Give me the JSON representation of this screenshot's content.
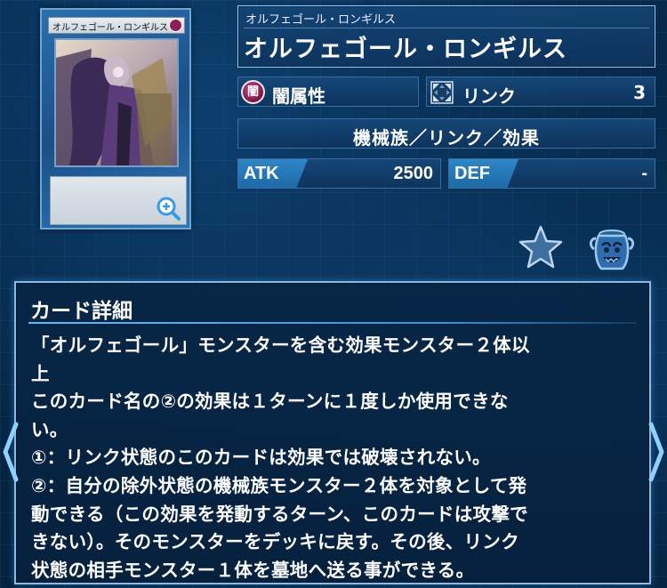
{
  "card": {
    "thumb_name": "オルフェゴール・ロンギルス",
    "name_ruby": "オルフェゴール・ロンギルス",
    "name": "オルフェゴール・ロンギルス",
    "attribute": {
      "label": "闇属性",
      "icon": "dark-attribute-icon",
      "glyph": "闇"
    },
    "link": {
      "label": "リンク",
      "value": "3",
      "icon": "link-arrows-icon"
    },
    "type_line": "機械族／リンク／効果",
    "atk": {
      "label": "ATK",
      "value": "2500"
    },
    "def": {
      "label": "DEF",
      "value": "-"
    }
  },
  "actions": {
    "favorite_icon": "star-icon",
    "deck_icon": "pot-of-greed-icon",
    "zoom_icon": "zoom-in-icon"
  },
  "detail": {
    "title": "カード詳細",
    "lines": [
      "「オルフェゴール」モンスターを含む効果モンスター２体以",
      "上",
      "このカード名の②の効果は１ターンに１度しか使用できな",
      "い。",
      "①：リンク状態のこのカードは効果では破壊されない。",
      "②：自分の除外状態の機械族モンスター２体を対象として発",
      "動できる（この効果を発動するターン、このカードは攻撃で",
      "きない）。そのモンスターをデッキに戻す。その後、リンク",
      "状態の相手モンスター１体を墓地へ送る事ができる。"
    ]
  },
  "nav": {
    "prev_icon": "chevron-left-icon",
    "next_icon": "chevron-right-icon"
  },
  "colors": {
    "accent": "#7fbef0",
    "dark_attribute": "#8a1f5a",
    "label_blue": "#2f86c7"
  }
}
